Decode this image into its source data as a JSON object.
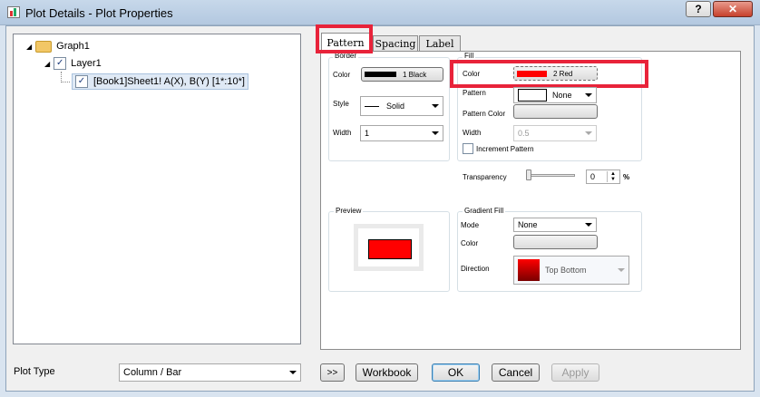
{
  "window": {
    "title": "Plot Details - Plot Properties"
  },
  "tree": {
    "graph": "Graph1",
    "layer": "Layer1",
    "plot": "[Book1]Sheet1! A(X), B(Y) [1*:10*]",
    "layer_checked": true,
    "plot_checked": true
  },
  "tabs": [
    {
      "label": "Pattern",
      "active": true
    },
    {
      "label": "Spacing",
      "active": false
    },
    {
      "label": "Label",
      "active": false
    }
  ],
  "border": {
    "group_label": "Border",
    "color_label": "Color",
    "color_value": "1 Black",
    "color_swatch": "#000000",
    "style_label": "Style",
    "style_value": "Solid",
    "width_label": "Width",
    "width_value": "1"
  },
  "fill": {
    "group_label": "Fill",
    "color_label": "Color",
    "color_value": "2 Red",
    "color_swatch": "#ff0000",
    "pattern_label": "Pattern",
    "pattern_value": "None",
    "pattern_color_label": "Pattern Color",
    "width_label": "Width",
    "width_value": "0.5",
    "increment_label": "Increment Pattern"
  },
  "transparency": {
    "label": "Transparency",
    "value": "0",
    "unit": "%",
    "level": 0
  },
  "preview": {
    "label": "Preview",
    "swatch": "#ff0000"
  },
  "gradient": {
    "group_label": "Gradient Fill",
    "mode_label": "Mode",
    "mode_value": "None",
    "color_label": "Color",
    "direction_label": "Direction",
    "direction_value": "Top Bottom"
  },
  "footer": {
    "plot_type_label": "Plot Type",
    "plot_type_value": "Column / Bar",
    "expand": ">>",
    "workbook": "Workbook",
    "ok": "OK",
    "cancel": "Cancel",
    "apply": "Apply"
  },
  "colors": {
    "highlight": "#e8233a",
    "accent": "#3c7fb1"
  }
}
